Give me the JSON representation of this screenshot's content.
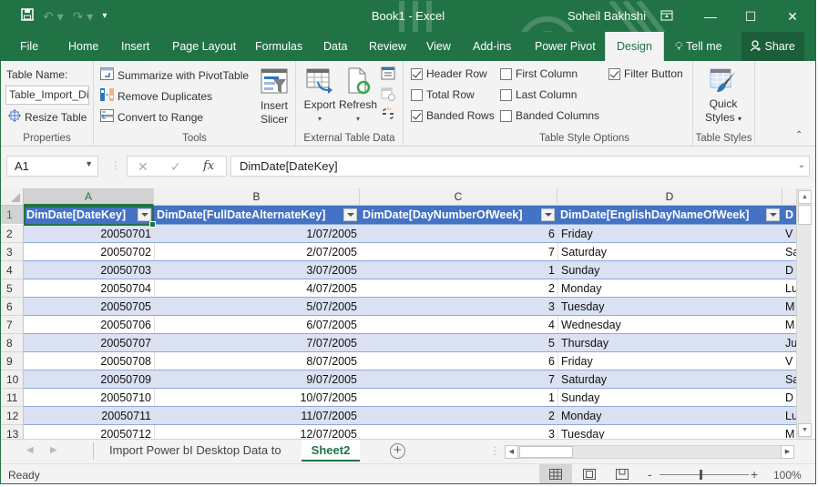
{
  "titlebar": {
    "title": "Book1  -  Excel",
    "user": "Soheil Bakhshi",
    "qat": {
      "save": "save-icon",
      "undo": "undo-icon",
      "redo": "redo-icon",
      "customize": "customize-qat-icon"
    },
    "minimize": "—",
    "maximize": "☐",
    "close": "✕",
    "ribbon_display": "ribbon-display-options-icon"
  },
  "tabs": [
    {
      "label": "File"
    },
    {
      "label": "Home"
    },
    {
      "label": "Insert"
    },
    {
      "label": "Page Layout"
    },
    {
      "label": "Formulas"
    },
    {
      "label": "Data"
    },
    {
      "label": "Review"
    },
    {
      "label": "View"
    },
    {
      "label": "Add-ins"
    },
    {
      "label": "Power Pivot"
    },
    {
      "label": "Design",
      "active": true
    },
    {
      "label": "Tell me"
    },
    {
      "label": "Share"
    }
  ],
  "ribbon": {
    "properties": {
      "label": "Properties",
      "table_name_label": "Table Name:",
      "table_name_value": "Table_Import_Di",
      "resize_table": "Resize Table"
    },
    "tools": {
      "label": "Tools",
      "summarize": "Summarize with PivotTable",
      "remove_duplicates": "Remove Duplicates",
      "convert_to_range": "Convert to Range",
      "insert_slicer_1": "Insert",
      "insert_slicer_2": "Slicer"
    },
    "external": {
      "label": "External Table Data",
      "export": "Export",
      "refresh": "Refresh"
    },
    "style_options": {
      "label": "Table Style Options",
      "header_row": {
        "label": "Header Row",
        "checked": true
      },
      "total_row": {
        "label": "Total Row",
        "checked": false
      },
      "banded_rows": {
        "label": "Banded Rows",
        "checked": true
      },
      "first_column": {
        "label": "First Column",
        "checked": false
      },
      "last_column": {
        "label": "Last Column",
        "checked": false
      },
      "banded_columns": {
        "label": "Banded Columns",
        "checked": false
      },
      "filter_button": {
        "label": "Filter Button",
        "checked": true
      }
    },
    "table_styles": {
      "label": "Table Styles",
      "quick_1": "Quick",
      "quick_2": "Styles"
    }
  },
  "formula_bar": {
    "name_box": "A1",
    "cancel": "✕",
    "enter": "✓",
    "fx": "fx",
    "value": "DimDate[DateKey]"
  },
  "grid": {
    "column_letters": [
      "A",
      "B",
      "C",
      "D"
    ],
    "selected_cell": "A1",
    "headers": [
      "DimDate[DateKey]",
      "DimDate[FullDateAlternateKey]",
      "DimDate[DayNumberOfWeek]",
      "DimDate[EnglishDayNameOfWeek]",
      "D"
    ],
    "rows": [
      {
        "n": "2",
        "a": "20050701",
        "b": "1/07/2005",
        "c": "6",
        "d": "Friday",
        "e": "V"
      },
      {
        "n": "3",
        "a": "20050702",
        "b": "2/07/2005",
        "c": "7",
        "d": "Saturday",
        "e": "Sa"
      },
      {
        "n": "4",
        "a": "20050703",
        "b": "3/07/2005",
        "c": "1",
        "d": "Sunday",
        "e": "D"
      },
      {
        "n": "5",
        "a": "20050704",
        "b": "4/07/2005",
        "c": "2",
        "d": "Monday",
        "e": "Lu"
      },
      {
        "n": "6",
        "a": "20050705",
        "b": "5/07/2005",
        "c": "3",
        "d": "Tuesday",
        "e": "M"
      },
      {
        "n": "7",
        "a": "20050706",
        "b": "6/07/2005",
        "c": "4",
        "d": "Wednesday",
        "e": "M"
      },
      {
        "n": "8",
        "a": "20050707",
        "b": "7/07/2005",
        "c": "5",
        "d": "Thursday",
        "e": "Ju"
      },
      {
        "n": "9",
        "a": "20050708",
        "b": "8/07/2005",
        "c": "6",
        "d": "Friday",
        "e": "V"
      },
      {
        "n": "10",
        "a": "20050709",
        "b": "9/07/2005",
        "c": "7",
        "d": "Saturday",
        "e": "Sa"
      },
      {
        "n": "11",
        "a": "20050710",
        "b": "10/07/2005",
        "c": "1",
        "d": "Sunday",
        "e": "D"
      },
      {
        "n": "12",
        "a": "20050711",
        "b": "11/07/2005",
        "c": "2",
        "d": "Monday",
        "e": "Lu"
      },
      {
        "n": "13",
        "a": "20050712",
        "b": "12/07/2005",
        "c": "3",
        "d": "Tuesday",
        "e": "M"
      }
    ],
    "row1_label": "1"
  },
  "sheets": [
    {
      "label": "Import Power bI Desktop Data to",
      "active": false
    },
    {
      "label": "Sheet2",
      "active": true
    }
  ],
  "add_sheet": "+",
  "status": {
    "text": "Ready",
    "zoom": "100%",
    "zoom_minus": "-",
    "zoom_plus": "+",
    "zoom_level": 100
  },
  "colors": {
    "accent": "#217346",
    "table_header": "#4472c4",
    "band": "#d9e1f2"
  }
}
